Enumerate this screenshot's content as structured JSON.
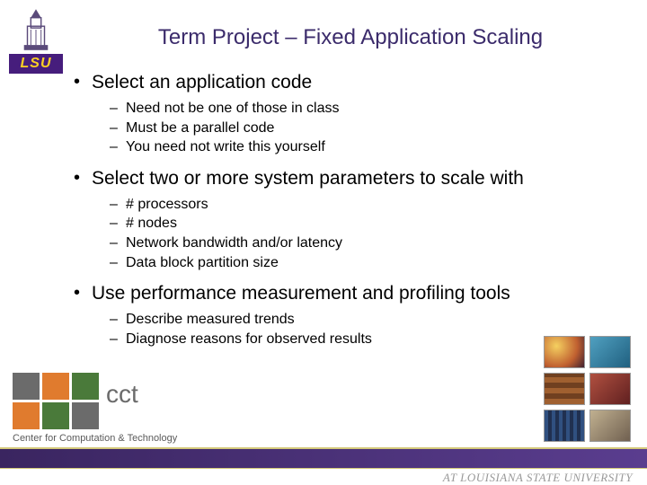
{
  "logo": {
    "org": "LSU"
  },
  "title": "Term Project – Fixed Application Scaling",
  "bullets": [
    {
      "text": "Select an application code",
      "sub": [
        "Need not be one of those in class",
        "Must be a parallel code",
        "You need not write this yourself"
      ]
    },
    {
      "text": "Select two or more system parameters to scale with",
      "sub": [
        "# processors",
        "# nodes",
        "Network bandwidth and/or latency",
        "Data block partition size"
      ]
    },
    {
      "text": "Use performance measurement and profiling tools",
      "sub": [
        "Describe measured trends",
        "Diagnose reasons for observed results"
      ]
    }
  ],
  "cct": {
    "abbr": "cct",
    "name": "Center for Computation & Technology"
  },
  "footer": "AT LOUISIANA STATE UNIVERSITY"
}
